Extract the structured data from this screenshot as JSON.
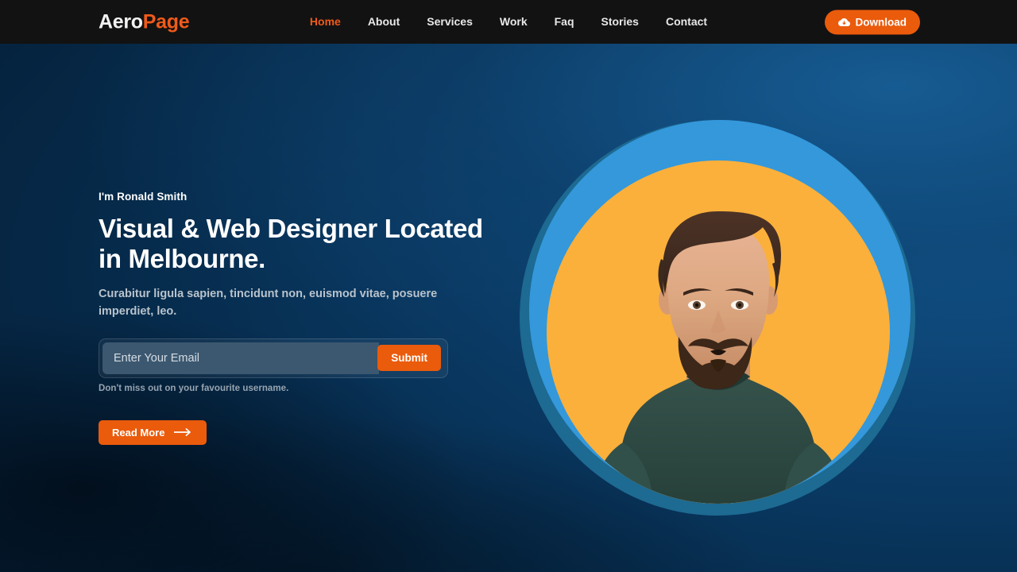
{
  "navbar": {
    "brand": {
      "part1": "Aero",
      "part2": "Page"
    },
    "links": [
      {
        "label": "Home",
        "active": true
      },
      {
        "label": "About",
        "active": false
      },
      {
        "label": "Services",
        "active": false
      },
      {
        "label": "Work",
        "active": false
      },
      {
        "label": "Faq",
        "active": false
      },
      {
        "label": "Stories",
        "active": false
      },
      {
        "label": "Contact",
        "active": false
      }
    ],
    "download_label": "Download",
    "download_icon": "cloud-download-icon"
  },
  "hero": {
    "eyebrow": "I'm Ronald Smith",
    "headline": "Visual & Web Designer Located in Melbourne.",
    "subtext": "Curabitur ligula sapien, tincidunt non, euismod vitae, posuere imperdiet, leo.",
    "form": {
      "placeholder": "Enter Your Email",
      "value": "",
      "submit_label": "Submit",
      "hint": "Don't miss out on your favourite username."
    },
    "cta": {
      "label": "Read More",
      "icon": "arrow-right-icon"
    },
    "portrait_alt": "Portrait of Ronald Smith"
  },
  "colors": {
    "accent_orange": "#ea5b0c",
    "brand_orange": "#ef5a1a",
    "navbar_bg": "#121212",
    "ring_outer": "#1d6a92",
    "ring_mid": "#3498db",
    "ring_inner": "#fbb03b",
    "hero_bg_dark": "#02101f",
    "hero_bg_light": "#0f4f86",
    "input_bg": "#3c5870",
    "shirt": "#2f4a44"
  }
}
